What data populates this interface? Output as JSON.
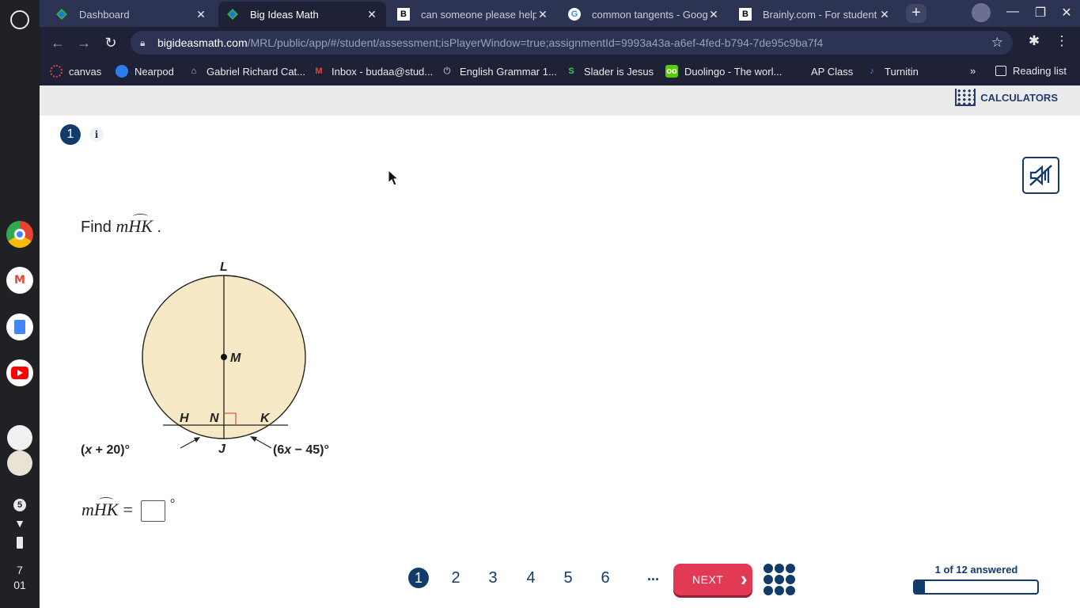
{
  "shelf": {
    "notification_count": "5",
    "clock_hour": "7",
    "clock_minute": "01",
    "apps": [
      "chrome-icon",
      "gmail-icon",
      "docs-icon",
      "youtube-icon",
      "blank-app-icon",
      "photo-app-icon"
    ]
  },
  "tabs": [
    {
      "title": "Dashboard",
      "favicon": "bim-icon",
      "active": false
    },
    {
      "title": "Big Ideas Math",
      "favicon": "bim-icon",
      "active": true
    },
    {
      "title": "can someone please help",
      "favicon": "brainly-icon",
      "active": false
    },
    {
      "title": "common tangents - Goog",
      "favicon": "google-icon",
      "active": false
    },
    {
      "title": "Brainly.com - For student",
      "favicon": "brainly-icon",
      "active": false
    }
  ],
  "address": {
    "host": "bigideasmath.com",
    "path": "/MRL/public/app/#/student/assessment;isPlayerWindow=true;assignmentId=9993a43a-a6ef-4fed-b794-7de95c9ba7f4"
  },
  "bookmarks": [
    {
      "label": "canvas",
      "icon": "canvas-icon",
      "color": "#e0443e"
    },
    {
      "label": "Nearpod",
      "icon": "nearpod-icon",
      "color": "#2b7de9"
    },
    {
      "label": "Gabriel Richard Cat...",
      "icon": "school-icon",
      "color": "#b8c0ff"
    },
    {
      "label": "Inbox - budaa@stud...",
      "icon": "gmail-icon",
      "color": "#ea4335"
    },
    {
      "label": "English Grammar 1...",
      "icon": "power-icon",
      "color": "#9aa0b8"
    },
    {
      "label": "Slader is Jesus",
      "icon": "slader-icon",
      "color": "#34c759"
    },
    {
      "label": "Duolingo - The worl...",
      "icon": "duolingo-icon",
      "color": "#58cc02"
    },
    {
      "label": "AP Class",
      "icon": "ap-icon",
      "color": "#1f2237"
    },
    {
      "label": "Turnitin",
      "icon": "turnitin-icon",
      "color": "#4a90e2"
    }
  ],
  "reading_list": "Reading list",
  "more_bookmarks": "»",
  "page": {
    "calculators_label": "CALCULATORS",
    "question_number": "1",
    "info_label": "i",
    "prompt_prefix": "Find ",
    "prompt_math_var": "m",
    "prompt_arc": "HK",
    "prompt_suffix": " .",
    "figure_labels": {
      "L": "L",
      "M": "M",
      "H": "H",
      "N": "N",
      "K": "K",
      "J": "J",
      "left_expr_open": "(",
      "left_expr_x": "x",
      "left_expr_rest": " + 20)°",
      "right_expr_open": "(6",
      "right_expr_x": "x",
      "right_expr_rest": " − 45)°"
    },
    "answer_math_var": "m",
    "answer_arc": "HK",
    "answer_eq": "=",
    "answer_value": "",
    "answer_unit": "°"
  },
  "nav": {
    "pages": [
      "1",
      "2",
      "3",
      "4",
      "5",
      "6"
    ],
    "current_page": "1",
    "ellipsis": "...",
    "next_label": "NEXT",
    "progress_label": "1 of 12 answered",
    "progress_fraction": 0.0833
  },
  "colors": {
    "circle_fill": "#f7e9c6",
    "accent_navy": "#123b6a",
    "next_red": "#e23a55",
    "right_angle": "#e05a3a"
  }
}
